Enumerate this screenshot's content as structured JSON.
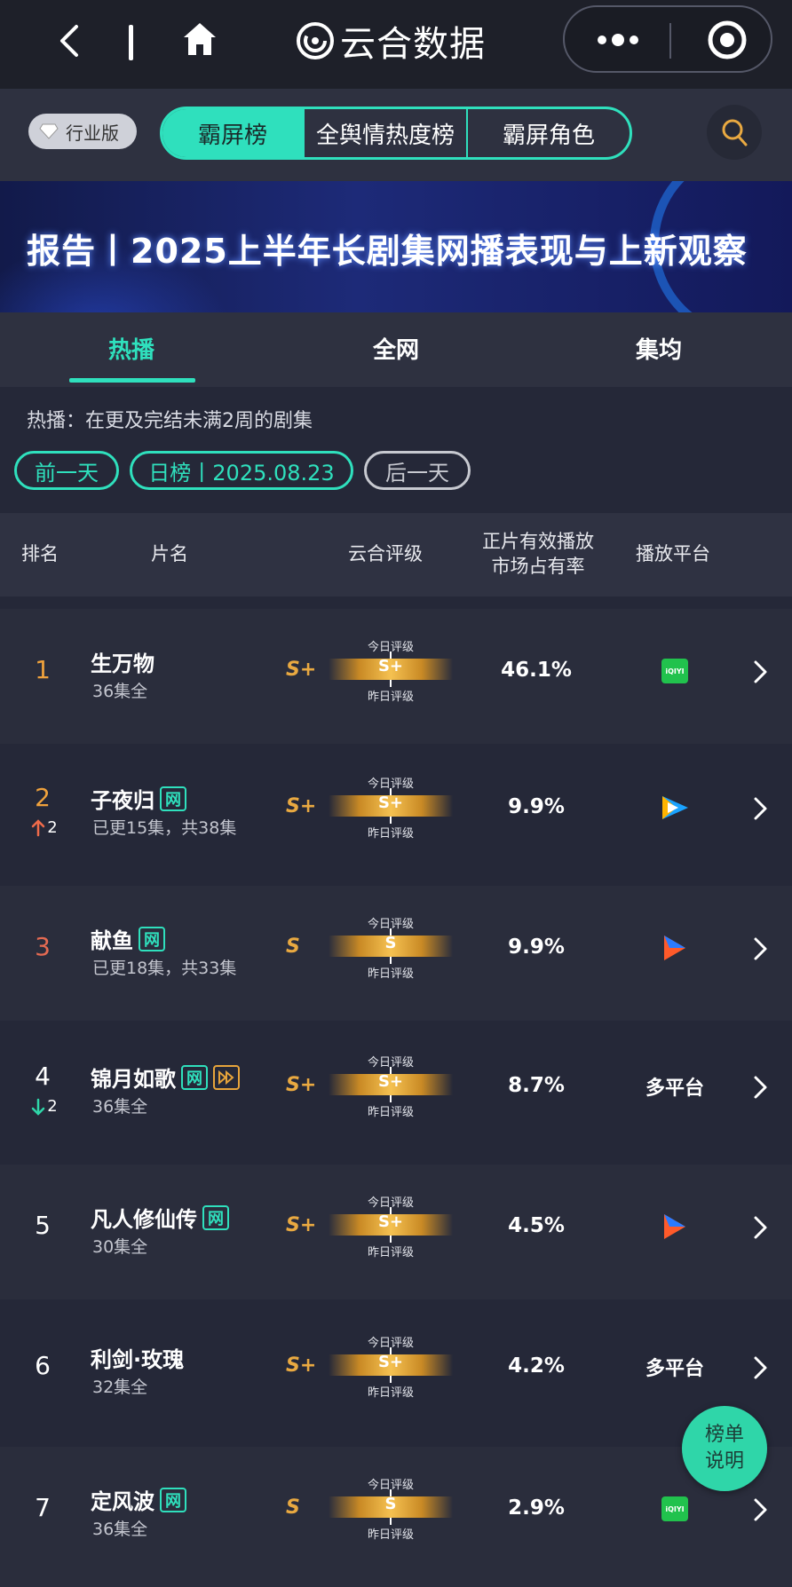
{
  "topbar": {
    "brand": "云合数据"
  },
  "tabbar": {
    "industry_label": "行业版",
    "tabs": [
      {
        "label": "霸屏榜",
        "active": true
      },
      {
        "label": "全舆情热度榜",
        "active": false
      },
      {
        "label": "霸屏角色",
        "active": false
      }
    ]
  },
  "banner": {
    "title": "报告丨2025上半年长剧集网播表现与上新观察"
  },
  "subtabs": [
    {
      "label": "热播",
      "active": true
    },
    {
      "label": "全网",
      "active": false
    },
    {
      "label": "集均",
      "active": false
    }
  ],
  "note": "热播：在更及完结未满2周的剧集",
  "date_nav": {
    "prev": "前一天",
    "current": "日榜丨2025.08.23",
    "next": "后一天"
  },
  "table": {
    "headers": {
      "rank": "排名",
      "title": "片名",
      "rating": "云合评级",
      "share_line1": "正片有效播放",
      "share_line2": "市场占有率",
      "platform": "播放平台"
    },
    "rating_labels": {
      "today": "今日评级",
      "yesterday": "昨日评级"
    },
    "rows": [
      {
        "rank": "1",
        "title": "生万物",
        "tags": [],
        "episodes": "36集全",
        "grade": "S+",
        "today_grade": "S+",
        "share": "46.1%",
        "platform": "iqiyi-icon",
        "platform_text": "",
        "delta": "",
        "delta_dir": ""
      },
      {
        "rank": "2",
        "title": "子夜归",
        "tags": [
          "网"
        ],
        "episodes": "已更15集，共38集",
        "grade": "S+",
        "today_grade": "S+",
        "share": "9.9%",
        "platform": "tencent-video-icon",
        "platform_text": "",
        "delta": "2",
        "delta_dir": "up"
      },
      {
        "rank": "3",
        "title": "献鱼",
        "tags": [
          "网"
        ],
        "episodes": "已更18集，共33集",
        "grade": "S",
        "today_grade": "S",
        "share": "9.9%",
        "platform": "youku-icon",
        "platform_text": "",
        "delta": "",
        "delta_dir": ""
      },
      {
        "rank": "4",
        "title": "锦月如歌",
        "tags": [
          "网",
          "▷"
        ],
        "episodes": "36集全",
        "grade": "S+",
        "today_grade": "S+",
        "share": "8.7%",
        "platform": "",
        "platform_text": "多平台",
        "delta": "2",
        "delta_dir": "down"
      },
      {
        "rank": "5",
        "title": "凡人修仙传",
        "tags": [
          "网"
        ],
        "episodes": "30集全",
        "grade": "S+",
        "today_grade": "S+",
        "share": "4.5%",
        "platform": "youku-icon",
        "platform_text": "",
        "delta": "",
        "delta_dir": ""
      },
      {
        "rank": "6",
        "title": "利剑·玫瑰",
        "tags": [],
        "episodes": "32集全",
        "grade": "S+",
        "today_grade": "S+",
        "share": "4.2%",
        "platform": "",
        "platform_text": "多平台",
        "delta": "",
        "delta_dir": ""
      },
      {
        "rank": "7",
        "title": "定风波",
        "tags": [
          "网"
        ],
        "episodes": "36集全",
        "grade": "S",
        "today_grade": "S",
        "share": "2.9%",
        "platform": "iqiyi-icon",
        "platform_text": "",
        "delta": "",
        "delta_dir": ""
      }
    ]
  },
  "float_button": {
    "line1": "榜单",
    "line2": "说明"
  },
  "iqiyi_text": "iQIYI",
  "colors": {
    "accent": "#2fe0bd",
    "gold": "#e9a941",
    "rank_orange": "#f0a23c",
    "rank_red": "#e46a52",
    "background": "#252838"
  }
}
